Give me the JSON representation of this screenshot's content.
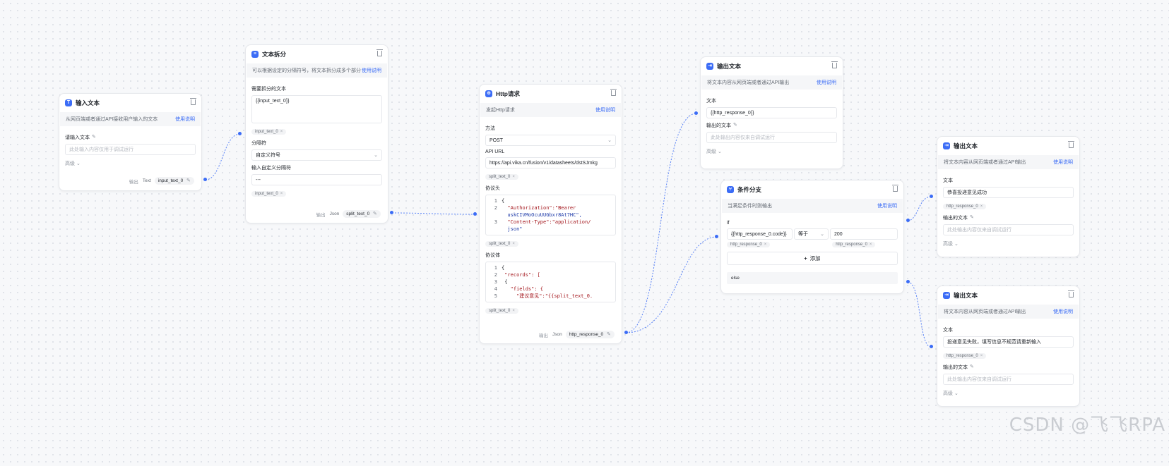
{
  "colors": {
    "accent": "#3b6cf6",
    "wire": "#3b6cf6",
    "canvas": "#f7f8fa"
  },
  "nodes": {
    "input_text": {
      "icon": "text-icon",
      "title": "输入文本",
      "desc": "从网页端或者通过API接收用户输入的文本",
      "help": "使用说明",
      "field_label": "请输入文本",
      "placeholder": "此处输入内容仅用于调试运行",
      "advanced": "高级",
      "output_label": "输出",
      "output_type": "Text",
      "output_var": "input_text_0"
    },
    "text_split": {
      "icon": "split-icon",
      "title": "文本拆分",
      "desc": "可以根据设定的分隔符号，将文本拆分成多个部分",
      "help": "使用说明",
      "field1_label": "需要拆分的文本",
      "field1_value": "{{input_text_0}}",
      "field1_tag": "input_text_0",
      "field2_label": "分隔符",
      "field2_value": "自定义符号",
      "field3_label": "输入自定义分隔符",
      "field3_value": "---",
      "field3_tag": "input_text_0",
      "output_label": "输出",
      "output_type": "Json",
      "output_var": "split_text_0"
    },
    "http": {
      "icon": "globe-icon",
      "title": "Http请求",
      "desc": "发起Http请求",
      "help": "使用说明",
      "method_label": "方法",
      "method_value": "POST",
      "url_label": "API URL",
      "url_value": "https://api.vika.cn/fusion/v1/datasheets/dstSJmkg",
      "url_tag": "split_text_0",
      "headers_label": "协议头",
      "headers_lines": [
        {
          "n": "1",
          "t": "{"
        },
        {
          "n": "2",
          "t": "  \"Authorization\":\"Bearer"
        },
        {
          "n": "",
          "t": "  uskCIVMoOcuUUGbxr8At7HC\","
        },
        {
          "n": "3",
          "t": "  \"Content-Type\":\"application/"
        },
        {
          "n": "",
          "t": "  json\""
        }
      ],
      "headers_tag": "split_text_0",
      "body_label": "协议体",
      "body_lines": [
        {
          "n": "1",
          "t": "{"
        },
        {
          "n": "2",
          "t": " \"records\": ["
        },
        {
          "n": "3",
          "t": " {"
        },
        {
          "n": "4",
          "t": "   \"fields\": {"
        },
        {
          "n": "5",
          "t": "     \"建议意见\":\"{{split_text_0."
        }
      ],
      "body_tag": "split_text_0",
      "output_label": "输出",
      "output_type": "Json",
      "output_var": "http_response_0"
    },
    "output_top": {
      "icon": "output-icon",
      "title": "输出文本",
      "desc": "将文本内容从网页端或者通过API输出",
      "help": "使用说明",
      "text_label": "文本",
      "text_value": "{{http_response_0}}",
      "out_label": "输出的文本",
      "out_placeholder": "此处输出内容仅来自调试运行",
      "advanced": "高级"
    },
    "condition": {
      "icon": "branch-icon",
      "title": "条件分支",
      "desc": "当满足条件时则输出",
      "help": "使用说明",
      "if_label": "if",
      "cond_left": "{{http_response_0.code}}",
      "cond_op": "等于",
      "cond_right": "200",
      "tag_left": "http_response_0",
      "tag_right": "http_response_0",
      "add_label": "添加",
      "else_label": "else"
    },
    "output_success": {
      "icon": "output-icon",
      "title": "输出文本",
      "desc": "将文本内容从网页端或者通过API输出",
      "help": "使用说明",
      "text_label": "文本",
      "text_value": "恭喜投递意见成功",
      "text_tag": "http_response_0",
      "out_label": "输出的文本",
      "out_placeholder": "此处输出内容仅来自调试运行",
      "advanced": "高级"
    },
    "output_fail": {
      "icon": "output-icon",
      "title": "输出文本",
      "desc": "将文本内容从网页端或者通过API输出",
      "help": "使用说明",
      "text_label": "文本",
      "text_value": "投递意见失败，填写信息不规范请重新输入",
      "text_tag": "http_response_0",
      "out_label": "输出的文本",
      "out_placeholder": "此处输出内容仅来自调试运行",
      "advanced": "高级"
    }
  },
  "watermark": "CSDN @飞飞RPA"
}
